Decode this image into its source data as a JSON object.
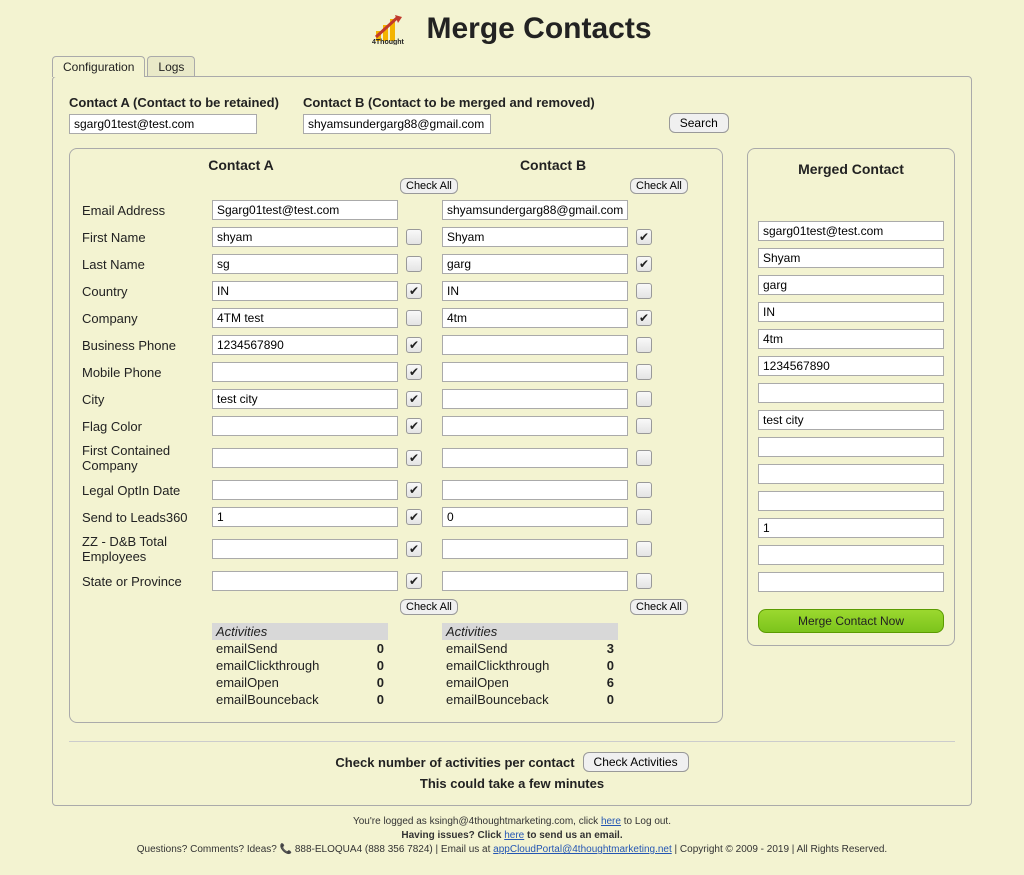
{
  "header": {
    "title": "Merge Contacts"
  },
  "tabs": {
    "configuration": "Configuration",
    "logs": "Logs"
  },
  "search": {
    "labelA": "Contact A (Contact to be retained)",
    "labelB": "Contact B (Contact to be merged and removed)",
    "valueA": "sgarg01test@test.com",
    "valueB": "shyamsundergarg88@gmail.com",
    "searchBtn": "Search"
  },
  "compare": {
    "headerA": "Contact A",
    "headerB": "Contact B",
    "checkAll": "Check All",
    "fields": [
      {
        "label": "Email Address",
        "a": "Sgarg01test@test.com",
        "b": "shyamsundergarg88@gmail.com",
        "chkA": false,
        "chkB": false,
        "noChk": true
      },
      {
        "label": "First Name",
        "a": "shyam",
        "b": "Shyam",
        "chkA": false,
        "chkB": true
      },
      {
        "label": "Last Name",
        "a": "sg",
        "b": "garg",
        "chkA": false,
        "chkB": true
      },
      {
        "label": "Country",
        "a": "IN",
        "b": "IN",
        "chkA": true,
        "chkB": false
      },
      {
        "label": "Company",
        "a": "4TM test",
        "b": "4tm",
        "chkA": false,
        "chkB": true
      },
      {
        "label": "Business Phone",
        "a": "1234567890",
        "b": "",
        "chkA": true,
        "chkB": false
      },
      {
        "label": "Mobile Phone",
        "a": "",
        "b": "",
        "chkA": true,
        "chkB": false
      },
      {
        "label": "City",
        "a": "test city",
        "b": "",
        "chkA": true,
        "chkB": false
      },
      {
        "label": "Flag Color",
        "a": "",
        "b": "",
        "chkA": true,
        "chkB": false
      },
      {
        "label": "First Contained Company",
        "a": "",
        "b": "",
        "chkA": true,
        "chkB": false
      },
      {
        "label": "Legal OptIn Date",
        "a": "",
        "b": "",
        "chkA": true,
        "chkB": false
      },
      {
        "label": "Send to Leads360",
        "a": "1",
        "b": "0",
        "chkA": true,
        "chkB": false
      },
      {
        "label": "ZZ - D&B Total Employees",
        "a": "",
        "b": "",
        "chkA": true,
        "chkB": false
      },
      {
        "label": "State or Province",
        "a": "",
        "b": "",
        "chkA": true,
        "chkB": false
      }
    ],
    "activitiesLabel": "Activities",
    "activitiesA": [
      {
        "name": "emailSend",
        "value": "0"
      },
      {
        "name": "emailClickthrough",
        "value": "0"
      },
      {
        "name": "emailOpen",
        "value": "0"
      },
      {
        "name": "emailBounceback",
        "value": "0"
      }
    ],
    "activitiesB": [
      {
        "name": "emailSend",
        "value": "3"
      },
      {
        "name": "emailClickthrough",
        "value": "0"
      },
      {
        "name": "emailOpen",
        "value": "6"
      },
      {
        "name": "emailBounceback",
        "value": "0"
      }
    ]
  },
  "merged": {
    "title": "Merged Contact",
    "values": [
      "sgarg01test@test.com",
      "Shyam",
      "garg",
      "IN",
      "4tm",
      "1234567890",
      "",
      "test city",
      "",
      "",
      "",
      "1",
      "",
      ""
    ],
    "mergeBtn": "Merge Contact Now"
  },
  "checkActivities": {
    "line1": "Check number of activities per contact",
    "btn": "Check Activities",
    "line2": "This could take a few minutes"
  },
  "footer": {
    "loggedPrefix": "You're logged as ksingh@4thoughtmarketing.com, click ",
    "here": "here",
    "loggedSuffix": " to Log out.",
    "issuesPrefix": "Having issues? Click ",
    "issuesSuffix": " to send us an email.",
    "infoPrefix": "Questions? Comments? Ideas? ",
    "phone": "888-ELOQUA4 (888 356 7824)",
    "emailPre": " | Email us at ",
    "emailLink": "appCloudPortal@4thoughtmarketing.net",
    "copyright": " | Copyright © 2009 - 2019 | All Rights Reserved."
  }
}
